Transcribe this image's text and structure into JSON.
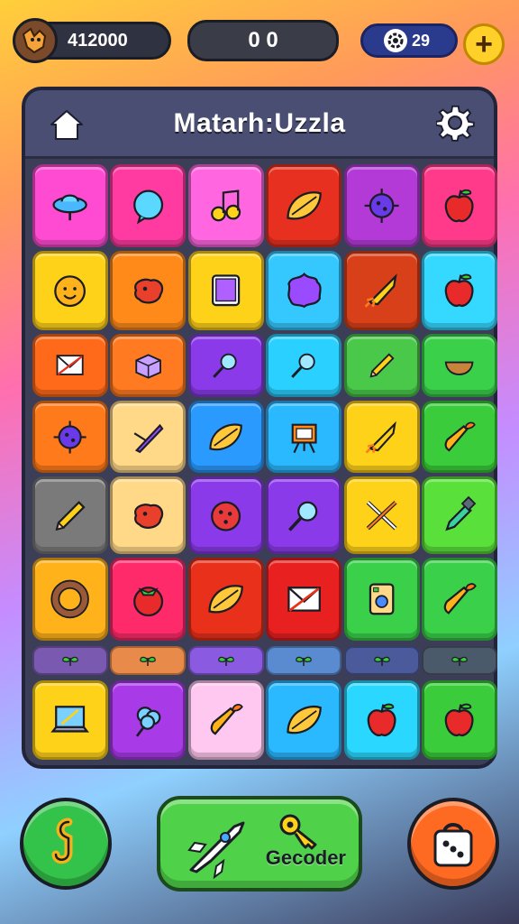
{
  "hud": {
    "coins": "412000",
    "score": "0 0",
    "gems": "29",
    "plus": "+"
  },
  "board": {
    "title": "Matarh:Uzzla"
  },
  "tiles": [
    {
      "color": "#ff4bd2",
      "icon": "ufo-icon"
    },
    {
      "color": "#ff3aa0",
      "icon": "bubble-icon"
    },
    {
      "color": "#ff66e0",
      "icon": "music-note-icon"
    },
    {
      "color": "#e83020",
      "icon": "leaf-icon"
    },
    {
      "color": "#b43ad8",
      "icon": "virus-icon"
    },
    {
      "color": "#ff3a8a",
      "icon": "apple-icon"
    },
    {
      "color": "#ffd21a",
      "icon": "smiley-icon"
    },
    {
      "color": "#ff8a1a",
      "icon": "blob-icon"
    },
    {
      "color": "#ffd21a",
      "icon": "tablet-icon"
    },
    {
      "color": "#35c8ff",
      "icon": "splat-icon"
    },
    {
      "color": "#d8401a",
      "icon": "rocket-icon"
    },
    {
      "color": "#35d8ff",
      "icon": "apple-icon"
    },
    {
      "color": "#ff6a1a",
      "icon": "envelope-icon"
    },
    {
      "color": "#ff7a20",
      "icon": "box-icon"
    },
    {
      "color": "#8a3ae8",
      "icon": "magnifier-icon"
    },
    {
      "color": "#2ad0ff",
      "icon": "magnifier-icon"
    },
    {
      "color": "#4ac84a",
      "icon": "pencil-icon"
    },
    {
      "color": "#3ad04a",
      "icon": "bowl-icon"
    },
    {
      "color": "#ff7a1a",
      "icon": "virus-icon"
    },
    {
      "color": "#ffd888",
      "icon": "knife-icon"
    },
    {
      "color": "#2a9aff",
      "icon": "leaf-icon"
    },
    {
      "color": "#2ab8ff",
      "icon": "easel-icon"
    },
    {
      "color": "#ffd21a",
      "icon": "rocket-icon"
    },
    {
      "color": "#3acc3a",
      "icon": "carrot-icon"
    },
    {
      "color": "#7a7a7a",
      "icon": "pencil-icon"
    },
    {
      "color": "#ffd888",
      "icon": "blob-icon"
    },
    {
      "color": "#8a3ae8",
      "icon": "berry-icon"
    },
    {
      "color": "#8a3ae8",
      "icon": "magnifier-icon"
    },
    {
      "color": "#ffd21a",
      "icon": "tools-icon"
    },
    {
      "color": "#5ae03a",
      "icon": "marker-icon"
    },
    {
      "color": "#ffb21a",
      "icon": "donut-icon"
    },
    {
      "color": "#ff2a6a",
      "icon": "tomato-icon"
    },
    {
      "color": "#e8301a",
      "icon": "leaf-icon"
    },
    {
      "color": "#e82020",
      "icon": "envelope-icon"
    },
    {
      "color": "#3ad04a",
      "icon": "device-icon"
    },
    {
      "color": "#3ad04a",
      "icon": "carrot-icon"
    },
    {
      "color": "#ffd21a",
      "icon": "laptop-icon"
    },
    {
      "color": "#a83ae8",
      "icon": "cotton-candy-icon"
    },
    {
      "color": "#ffc8f0",
      "icon": "carrot-icon"
    },
    {
      "color": "#2ab8ff",
      "icon": "leaf-icon"
    },
    {
      "color": "#2ad8ff",
      "icon": "apple-icon"
    },
    {
      "color": "#3acc3a",
      "icon": "apple-icon"
    }
  ],
  "strip": [
    {
      "color": "#7a5ab0",
      "icon": "sprout-icon"
    },
    {
      "color": "#e88a4a",
      "icon": "sprout-icon"
    },
    {
      "color": "#8a5ae0",
      "icon": "sprout-icon"
    },
    {
      "color": "#5a8ad0",
      "icon": "sprout-icon"
    },
    {
      "color": "#4a5a9a",
      "icon": "sprout-icon"
    },
    {
      "color": "#4a5a6a",
      "icon": "sprout-icon"
    }
  ],
  "bottom": {
    "center_label": "Gecoder"
  }
}
